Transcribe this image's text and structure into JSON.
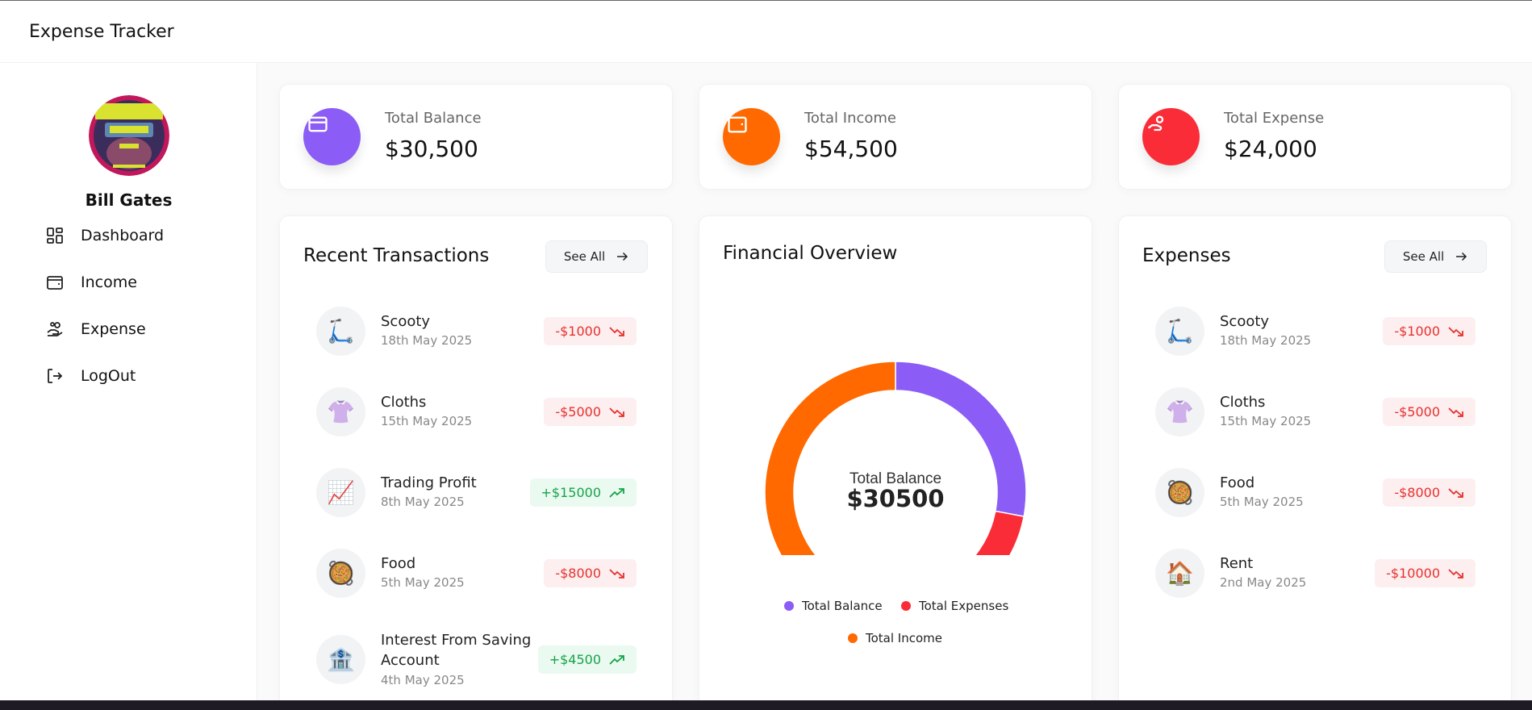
{
  "app": {
    "title": "Expense Tracker"
  },
  "sidebar": {
    "user_name": "Bill Gates",
    "avatar": "avatar-image",
    "items": [
      {
        "label": "Dashboard",
        "icon": "dashboard-icon"
      },
      {
        "label": "Income",
        "icon": "wallet-icon"
      },
      {
        "label": "Expense",
        "icon": "hand-coins-icon"
      },
      {
        "label": "LogOut",
        "icon": "logout-icon"
      }
    ]
  },
  "stats": [
    {
      "label": "Total Balance",
      "value": "$30,500",
      "color": "#8b5cf6",
      "icon": "card-icon"
    },
    {
      "label": "Total Income",
      "value": "$54,500",
      "color": "#ff6900",
      "icon": "wallet-icon"
    },
    {
      "label": "Total Expense",
      "value": "$24,000",
      "color": "#fa2c37",
      "icon": "hand-coins-icon"
    }
  ],
  "recent": {
    "title": "Recent Transactions",
    "see_all": "See All",
    "items": [
      {
        "name": "Scooty",
        "date": "18th May 2025",
        "amount": "-$1000",
        "type": "expense",
        "icon": "🛴"
      },
      {
        "name": "Cloths",
        "date": "15th May 2025",
        "amount": "-$5000",
        "type": "expense",
        "icon": "👚"
      },
      {
        "name": "Trading Profit",
        "date": "8th May 2025",
        "amount": "+$15000",
        "type": "income",
        "icon": "📈"
      },
      {
        "name": "Food",
        "date": "5th May 2025",
        "amount": "-$8000",
        "type": "expense",
        "icon": "🥘"
      },
      {
        "name": "Interest From Saving Account",
        "date": "4th May 2025",
        "amount": "+$4500",
        "type": "income",
        "icon": "🏦"
      }
    ]
  },
  "overview": {
    "title": "Financial Overview",
    "center_label": "Total Balance",
    "center_value": "$30500",
    "colors": {
      "balance": "#8b5cf6",
      "expenses": "#fa2c37",
      "income": "#ff6900"
    }
  },
  "chart_data": {
    "type": "pie",
    "categories": [
      "Total Balance",
      "Total Expenses",
      "Total Income"
    ],
    "values": [
      30500,
      24000,
      54500
    ],
    "legend": "bottom"
  },
  "expenses": {
    "title": "Expenses",
    "see_all": "See All",
    "items": [
      {
        "name": "Scooty",
        "date": "18th May 2025",
        "amount": "-$1000",
        "icon": "🛴"
      },
      {
        "name": "Cloths",
        "date": "15th May 2025",
        "amount": "-$5000",
        "icon": "👚"
      },
      {
        "name": "Food",
        "date": "5th May 2025",
        "amount": "-$8000",
        "icon": "🥘"
      },
      {
        "name": "Rent",
        "date": "2nd May 2025",
        "amount": "-$10000",
        "icon": "🏠"
      }
    ]
  }
}
